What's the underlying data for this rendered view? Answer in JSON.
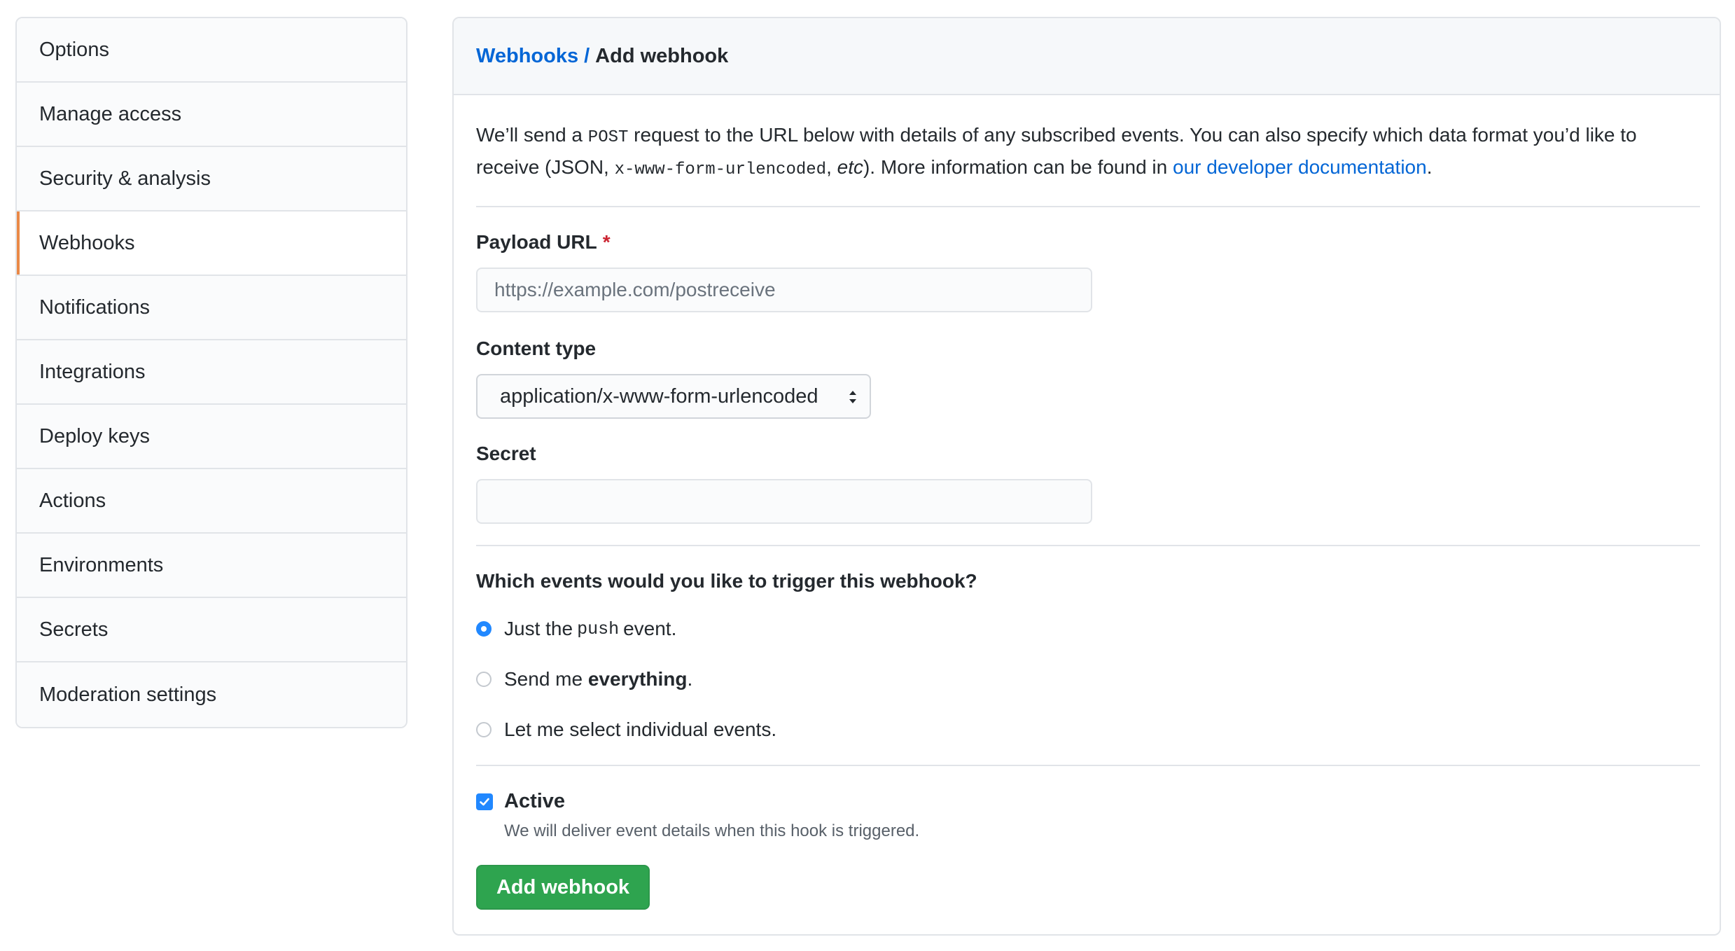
{
  "sidebar": {
    "items": [
      {
        "label": "Options"
      },
      {
        "label": "Manage access"
      },
      {
        "label": "Security & analysis"
      },
      {
        "label": "Webhooks"
      },
      {
        "label": "Notifications"
      },
      {
        "label": "Integrations"
      },
      {
        "label": "Deploy keys"
      },
      {
        "label": "Actions"
      },
      {
        "label": "Environments"
      },
      {
        "label": "Secrets"
      },
      {
        "label": "Moderation settings"
      }
    ],
    "selected": "Webhooks"
  },
  "header": {
    "breadcrumb_link": "Webhooks",
    "breadcrumb_sep": "/",
    "title": "Add webhook"
  },
  "intro": {
    "part1": "We’ll send a ",
    "code1": "POST",
    "part2": " request to the URL below with details of any subscribed events. You can also specify which data format you’d like to receive (JSON, ",
    "code2": "x-www-form-urlencoded",
    "part3": ", ",
    "em": "etc",
    "part4": "). More information can be found in ",
    "link": "our developer documentation",
    "part5": "."
  },
  "form": {
    "payload_label": "Payload URL",
    "payload_required": "*",
    "payload_placeholder": "https://example.com/postreceive",
    "payload_value": "",
    "content_type_label": "Content type",
    "content_type_value": "application/x-www-form-urlencoded",
    "secret_label": "Secret",
    "secret_value": ""
  },
  "events": {
    "question": "Which events would you like to trigger this webhook?",
    "option1_pre": "Just the",
    "option1_code": "push",
    "option1_post": "event.",
    "option2_pre": "Send me ",
    "option2_bold": "everything",
    "option2_post": ".",
    "option3": "Let me select individual events.",
    "selected_option": 1
  },
  "active": {
    "label": "Active",
    "checked": true,
    "note": "We will deliver event details when this hook is triggered."
  },
  "submit_label": "Add webhook",
  "colors": {
    "link": "#0366d6",
    "accent_selected": "#e36209",
    "primary_button": "#2ea44f",
    "radio_checkbox": "#2188ff",
    "required": "#cb2431"
  }
}
